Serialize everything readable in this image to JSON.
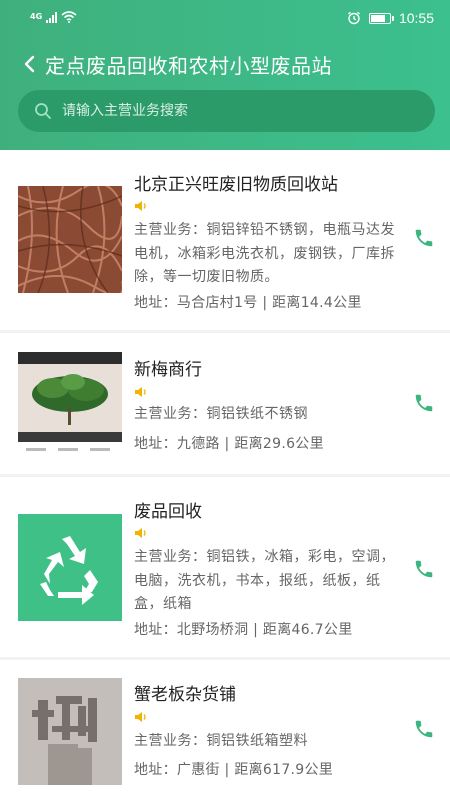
{
  "status_bar": {
    "network": "4G",
    "time": "10:55",
    "battery_level": 0.8,
    "icons": [
      "signal-icon",
      "wifi-icon",
      "alarm-icon",
      "battery-icon"
    ]
  },
  "header": {
    "title": "定点废品回收和农村小型废品站",
    "back_icon": "chevron-left-icon"
  },
  "search": {
    "placeholder": "请输入主营业务搜索",
    "value": ""
  },
  "colors": {
    "header_gradient_start": "#3fb07d",
    "header_gradient_end": "#3cc08e",
    "search_bg": "#2b9b6a",
    "phone_icon": "#3cb57f",
    "speaker_icon": "#f0b400",
    "recycle_tile": "#3ec087"
  },
  "stations": [
    {
      "name": "北京正兴旺废旧物质回收站",
      "business": "主营业务：铜铝锌铅不锈钢，电瓶马达发电机，冰箱彩电洗衣机，废钢铁，厂库拆除，等一切废旧物质。",
      "address": "地址：马合店村1号 | 距离14.4公里",
      "thumbnail": "copper-wire-photo"
    },
    {
      "name": "新梅商行",
      "business": "主营业务：铜铝铁纸不锈钢",
      "address": "地址：九德路 | 距离29.6公里",
      "thumbnail": "plant-screenshot-photo"
    },
    {
      "name": "废品回收",
      "business": "主营业务：铜铝铁，冰箱，彩电，空调，电脑，洗衣机，书本，报纸，纸板，纸盒，纸箱",
      "address": "地址：北野场桥洞 | 距离46.7公里",
      "thumbnail": "recycle-icon"
    },
    {
      "name": "蟹老板杂货铺",
      "business": "主营业务：铜铝铁纸箱塑料",
      "address": "地址：广惠街 | 距离617.9公里",
      "thumbnail": "blurred-text-photo"
    }
  ]
}
